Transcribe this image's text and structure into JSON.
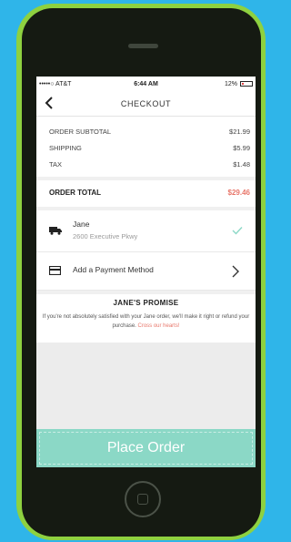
{
  "status_bar": {
    "carrier": "•••••○ AT&T",
    "time": "6:44 AM",
    "battery": "12%"
  },
  "nav": {
    "back_icon": "chevron-left-icon",
    "title": "CHECKOUT"
  },
  "summary": {
    "rows": [
      {
        "label": "ORDER SUBTOTAL",
        "value": "$21.99"
      },
      {
        "label": "SHIPPING",
        "value": "$5.99"
      },
      {
        "label": "TAX",
        "value": "$1.48"
      }
    ],
    "total_label": "ORDER TOTAL",
    "total_value": "$29.46"
  },
  "delivery": {
    "icon": "truck-icon",
    "name": "Jane",
    "address": "2600 Executive Pkwy",
    "status_icon": "check-icon"
  },
  "payment": {
    "icon": "credit-card-icon",
    "label": "Add a Payment Method",
    "arrow_icon": "chevron-right-icon"
  },
  "promise": {
    "title": "JANE'S PROMISE",
    "text": "If you're not absolutely satisfied with your Jane order, we'll make it right or refund your purchase.",
    "link": "Cross our hearts!"
  },
  "place_order_label": "Place Order",
  "colors": {
    "background": "#2fb5e9",
    "phone_body": "#8ed140",
    "accent": "#8bd8c6",
    "total_value": "#e8766a"
  }
}
